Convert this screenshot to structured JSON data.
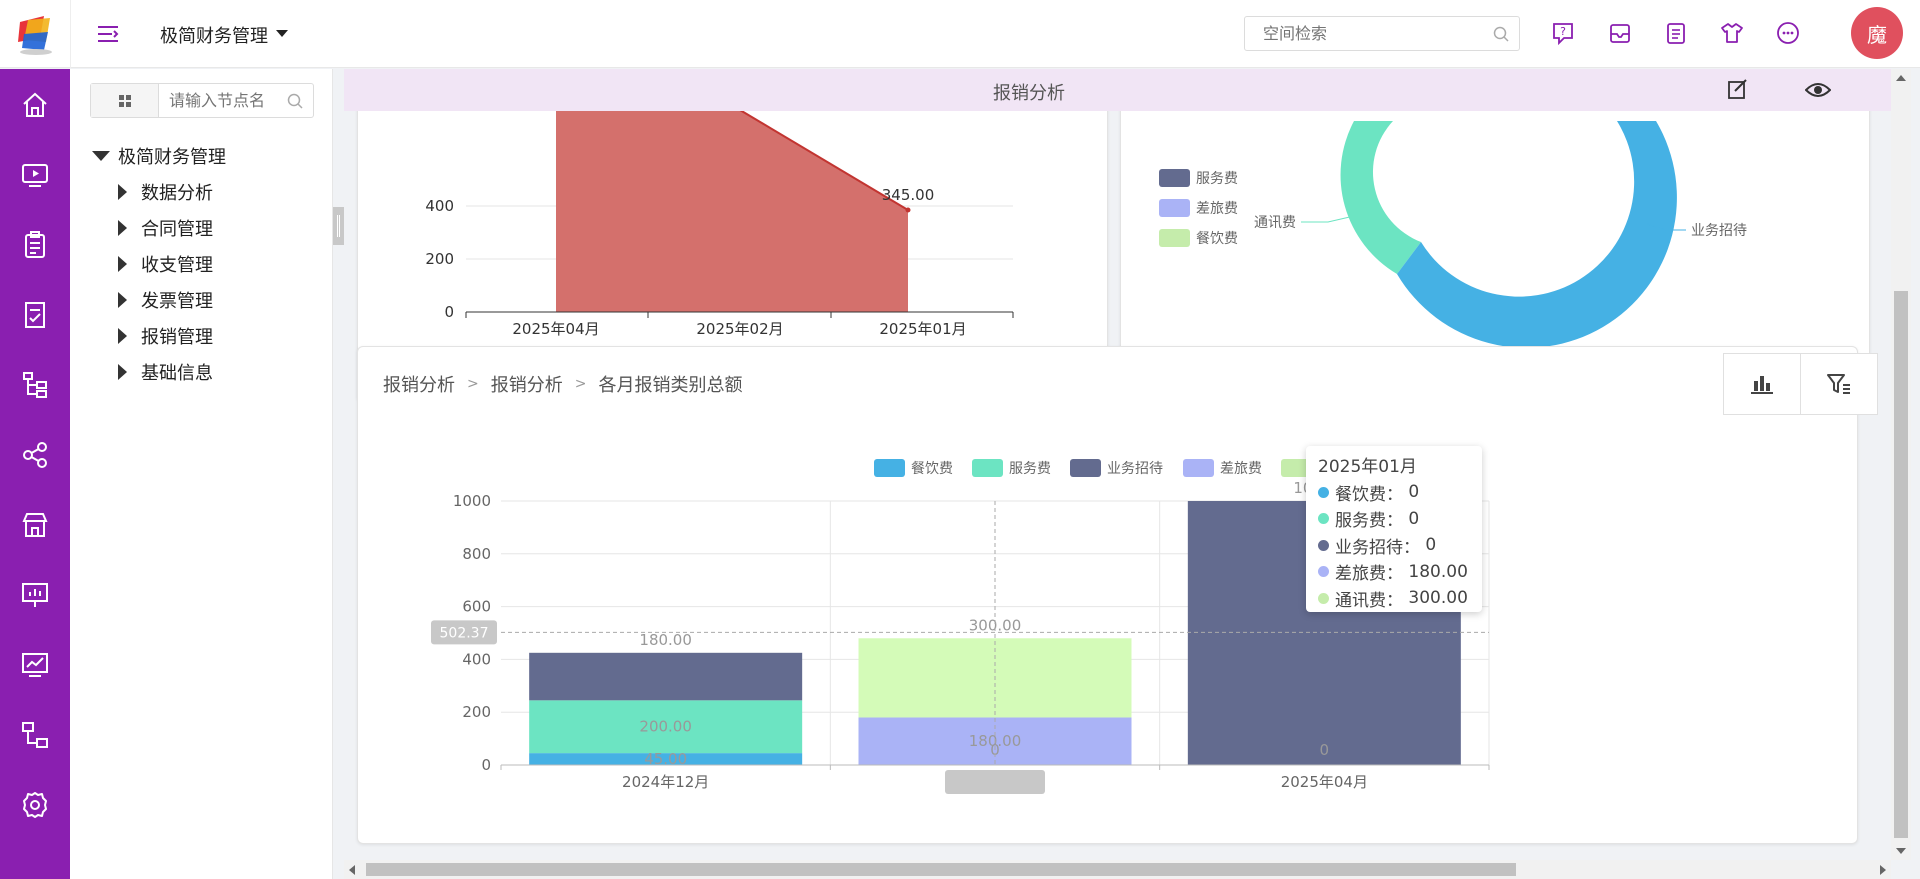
{
  "header": {
    "app_title": "极简财务管理",
    "search_placeholder": "空间检索",
    "avatar_text": "魔"
  },
  "tree": {
    "search_placeholder": "请输入节点名",
    "root": "极简财务管理",
    "children": [
      "数据分析",
      "合同管理",
      "收支管理",
      "发票管理",
      "报销管理",
      "基础信息"
    ]
  },
  "title_bar": {
    "title": "报销分析"
  },
  "colors": {
    "brand_purple": "#8a1fb0",
    "title_bar_bg": "#f1e5f5",
    "avatar": "#e0505e",
    "area_red": "#d4706c",
    "餐饮费": "#45b1e4",
    "服务费": "#6ce4c2",
    "业务招待": "#636b8f",
    "差旅费": "#aab3f6",
    "通讯费": "#d4fbb8"
  },
  "top_left_chart": {
    "type": "area",
    "categories": [
      "2025年04月",
      "2025年02月",
      "2025年01月"
    ],
    "values": [
      1000,
      1000,
      345
    ],
    "y_ticks": [
      "0",
      "200",
      "400"
    ],
    "data_label": "345.00"
  },
  "top_right_chart": {
    "type": "pie",
    "legend": [
      "服务费",
      "差旅费",
      "餐饮费"
    ],
    "labels": [
      "通讯费",
      "业务招待"
    ]
  },
  "bottom_card": {
    "breadcrumb": [
      "报销分析",
      "报销分析",
      "各月报销类别总额"
    ]
  },
  "chart_data": {
    "type": "bar",
    "stacked": true,
    "categories": [
      "2024年12月",
      "2025年01月",
      "2025年04月"
    ],
    "series": [
      {
        "name": "餐饮费",
        "values": [
          45,
          0,
          0
        ]
      },
      {
        "name": "服务费",
        "values": [
          200,
          0,
          0
        ]
      },
      {
        "name": "业务招待",
        "values": [
          180,
          0,
          1000
        ]
      },
      {
        "name": "差旅费",
        "values": [
          0,
          180,
          0
        ]
      },
      {
        "name": "通讯费",
        "values": [
          0,
          300,
          0
        ]
      }
    ],
    "data_labels": [
      {
        "category": "2024年12月",
        "texts": [
          "45.00",
          "200.00",
          "180.00"
        ]
      },
      {
        "category": "2025年01月",
        "texts": [
          "0",
          "180.00",
          "300.00"
        ]
      },
      {
        "category": "2025年04月",
        "texts": [
          "0",
          "1000.00"
        ]
      }
    ],
    "y_ticks": [
      "0",
      "200",
      "400",
      "600",
      "800",
      "1000"
    ],
    "ylim": [
      0,
      1000
    ],
    "axis_pointer_value": "502.37",
    "axis_pointer_category": "2025年01月",
    "legend": [
      "餐饮费",
      "服务费",
      "业务招待",
      "差旅费",
      "通讯费"
    ],
    "legend_position": "top"
  },
  "tooltip": {
    "title": "2025年01月",
    "rows": [
      {
        "label": "餐饮费：",
        "value": "0"
      },
      {
        "label": "服务费：",
        "value": "0"
      },
      {
        "label": "业务招待：",
        "value": "0"
      },
      {
        "label": "差旅费：",
        "value": "180.00"
      },
      {
        "label": "通讯费：",
        "value": "300.00"
      }
    ]
  }
}
